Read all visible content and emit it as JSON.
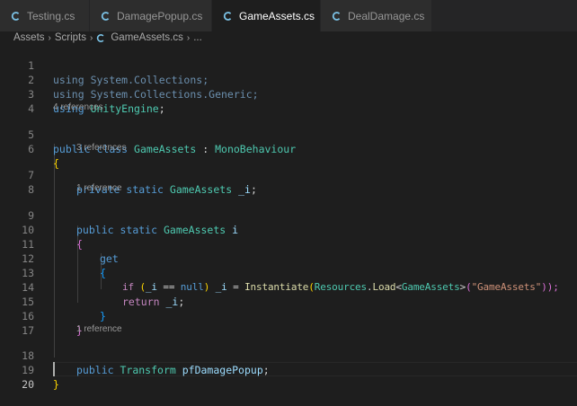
{
  "tabs": [
    {
      "label": "Testing.cs",
      "active": false
    },
    {
      "label": "DamagePopup.cs",
      "active": false
    },
    {
      "label": "GameAssets.cs",
      "active": true
    },
    {
      "label": "DealDamage.cs",
      "active": false
    }
  ],
  "breadcrumb": [
    "Assets",
    "Scripts",
    "GameAssets.cs",
    "..."
  ],
  "code_lenses": {
    "class": "4 references",
    "field": "3 references",
    "property": "1 reference",
    "transform": "1 reference"
  },
  "line_numbers": [
    "1",
    "2",
    "3",
    "4",
    "5",
    "6",
    "7",
    "8",
    "9",
    "10",
    "11",
    "12",
    "13",
    "14",
    "15",
    "16",
    "17",
    "18",
    "19",
    "20"
  ],
  "code": {
    "l1": [
      "using",
      "System",
      ".",
      "Collections",
      ";"
    ],
    "l2": [
      "using",
      "System",
      ".",
      "Collections",
      ".",
      "Generic",
      ";"
    ],
    "l3": [
      "using",
      "UnityEngine",
      ";"
    ],
    "l5": [
      "public",
      "class",
      "GameAssets",
      ":",
      "MonoBehaviour"
    ],
    "l6": [
      "{"
    ],
    "l7": [
      "private",
      "static",
      "GameAssets",
      "_i",
      ";"
    ],
    "l9": [
      "public",
      "static",
      "GameAssets",
      "i"
    ],
    "l10": [
      "{"
    ],
    "l11": [
      "get"
    ],
    "l12": [
      "{"
    ],
    "l13": [
      "if",
      "(",
      "_i",
      "==",
      "null",
      ")",
      "_i",
      "=",
      "Instantiate",
      "(",
      "Resources",
      ".",
      "Load",
      "<",
      "GameAssets",
      ">",
      "(",
      "\"GameAssets\"",
      "));"
    ],
    "l14": [
      "return",
      "_i",
      ";"
    ],
    "l15": [
      "}"
    ],
    "l16": [
      "}"
    ],
    "l18": [
      "public",
      "Transform",
      "pfDamagePopup",
      ";"
    ],
    "l19": [
      "}"
    ]
  },
  "colors": {
    "keyword": "#569cd6",
    "control": "#c586c0",
    "type": "#4ec9b0",
    "function": "#dcdcaa",
    "variable": "#9cdcfe",
    "string": "#ce9178",
    "bracket_gold": "#ffd700",
    "bracket_orchid": "#da70d6",
    "bracket_blue": "#179fff"
  },
  "icons": {
    "tab_file": "csharp-file-icon",
    "close": "close-icon",
    "breadcrumb_sep": "chevron-right-icon"
  }
}
